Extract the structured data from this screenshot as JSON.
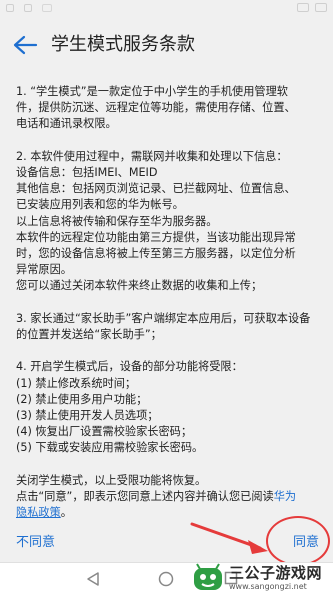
{
  "header": {
    "title": "学生模式服务条款"
  },
  "terms": {
    "p1": [
      "1. “学生模式”是一款定位于中小学生的手机使用管理软",
      "件，提供防沉迷、远程定位等功能，需使用存储、位置、",
      "电话和通讯录权限。"
    ],
    "p2": [
      "2. 本软件使用过程中，需联网并收集和处理以下信息：",
      "设备信息：包括IMEI、MEID",
      "其他信息：包括网页浏览记录、已拦截网址、位置信息、",
      "已安装应用列表和您的华为帐号。",
      "以上信息将被传输和保存至华为服务器。",
      "本软件的远程定位功能由第三方提供，当该功能出现异常",
      "时，您的设备信息将被上传至第三方服务器，以定位分析",
      "异常原因。",
      "您可以通过关闭本软件来终止数据的收集和上传；"
    ],
    "p3": [
      "3. 家长通过“家长助手”客户端绑定本应用后，可获取本设备",
      "的位置并发送给“家长助手”；"
    ],
    "p4": [
      "4. 开启学生模式后，设备的部分功能将受限：",
      "(1) 禁止修改系统时间；",
      "(2) 禁止使用多用户功能；",
      "(3) 禁止使用开发人员选项；",
      "(4) 恢复出厂设置需校验家长密码；",
      "(5) 下载或安装应用需校验家长密码。"
    ],
    "closing_line": "关闭学生模式，以上受限功能将恢复。",
    "consent_prefix": "点击“同意”，即表示您同意上述内容并确认您已阅读",
    "consent_link_part1": "华为",
    "consent_link_part2": "隐私政策",
    "consent_suffix": "。"
  },
  "footer": {
    "disagree_label": "不同意",
    "agree_label": "同意"
  },
  "watermark": {
    "name": "三公子游戏网",
    "url": "www.sangongzi.net"
  },
  "colors": {
    "background": "#f0f0f0",
    "link": "#1e6fd0",
    "annotation": "#e53b3b"
  }
}
